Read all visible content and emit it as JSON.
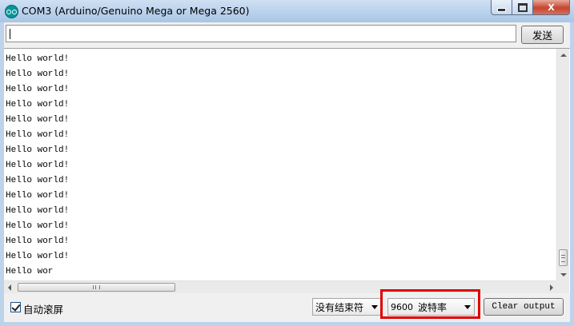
{
  "window": {
    "title": "COM3 (Arduino/Genuino Mega or Mega 2560)",
    "close_glyph": "X"
  },
  "send": {
    "input_value": "",
    "button_label": "发送"
  },
  "output": {
    "lines": [
      "Hello world!",
      "Hello world!",
      "Hello world!",
      "Hello world!",
      "Hello world!",
      "Hello world!",
      "Hello world!",
      "Hello world!",
      "Hello world!",
      "Hello world!",
      "Hello world!",
      "Hello world!",
      "Hello world!",
      "Hello world!",
      "Hello wor"
    ],
    "vscroll_grip": "",
    "hscroll_grip": "III"
  },
  "footer": {
    "autoscroll_label": "自动滚屏",
    "autoscroll_checked": true,
    "line_ending": "没有结束符",
    "baud_value": "9600",
    "baud_unit": "波特率",
    "clear_label": "Clear output"
  },
  "colors": {
    "highlight": "#e00000",
    "title_bar": "#b9d1ec",
    "close_button": "#c7442c"
  },
  "icons": {
    "app": "arduino-icon",
    "minimize": "minimize-icon",
    "maximize": "maximize-icon",
    "close": "close-icon"
  }
}
